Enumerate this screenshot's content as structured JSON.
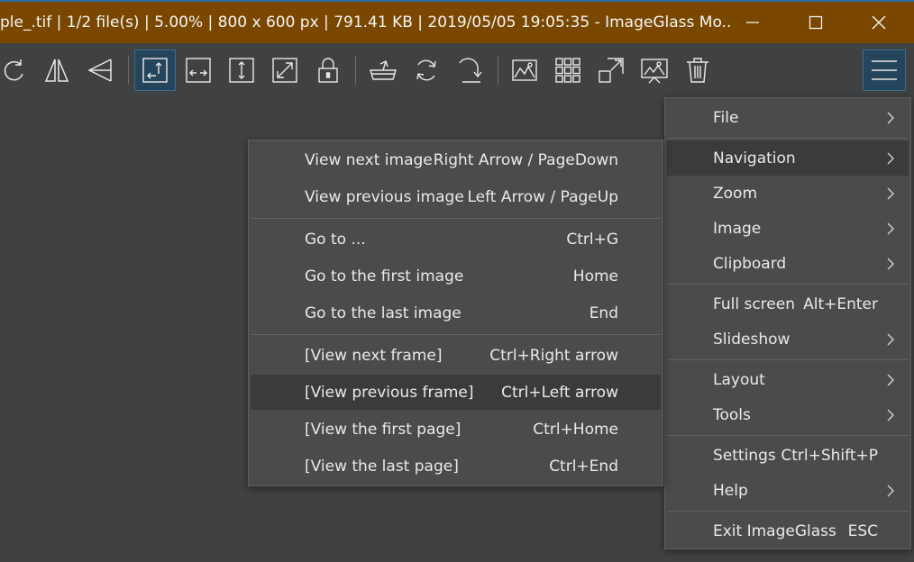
{
  "titlebar": {
    "text": "ple_.tif  |  1/2 file(s)  |  5.00%  |  800 x 600 px  |  791.41 KB  |  2019/05/05 19:05:35  - ImageGlass Mo..."
  },
  "toolbar": {
    "icons": [
      "rotate-right-icon",
      "flip-horizontal-icon",
      "flip-vertical-icon",
      "auto-zoom-icon",
      "fit-width-icon",
      "fit-height-icon",
      "scale-to-fill-icon",
      "lock-zoom-icon",
      "open-with-icon",
      "refresh-icon",
      "goto-icon",
      "set-wallpaper-icon",
      "thumbnail-icon",
      "fullscreen-icon",
      "slideshow-icon",
      "delete-icon",
      "main-menu-icon"
    ],
    "active_icon": "auto-zoom-icon",
    "active_color": "#25455c"
  },
  "main_menu": {
    "items": [
      {
        "label": "File",
        "shortcut": "",
        "submenu": true
      },
      {
        "label": "Navigation",
        "shortcut": "",
        "submenu": true
      },
      {
        "label": "Zoom",
        "shortcut": "",
        "submenu": true
      },
      {
        "label": "Image",
        "shortcut": "",
        "submenu": true
      },
      {
        "label": "Clipboard",
        "shortcut": "",
        "submenu": true
      },
      {
        "label": "Full screen",
        "shortcut": "Alt+Enter",
        "submenu": false
      },
      {
        "label": "Slideshow",
        "shortcut": "",
        "submenu": true
      },
      {
        "label": "Layout",
        "shortcut": "",
        "submenu": true
      },
      {
        "label": "Tools",
        "shortcut": "",
        "submenu": true
      },
      {
        "label": "Settings",
        "shortcut": "Ctrl+Shift+P",
        "submenu": false
      },
      {
        "label": "Help",
        "shortcut": "",
        "submenu": true
      },
      {
        "label": "Exit ImageGlass",
        "shortcut": "ESC",
        "submenu": false
      }
    ],
    "highlighted": "Navigation"
  },
  "nav_menu": {
    "items": [
      {
        "label": "View next image",
        "shortcut": "Right Arrow / PageDown"
      },
      {
        "label": "View previous image",
        "shortcut": "Left Arrow / PageUp"
      },
      {
        "label": "Go to ...",
        "shortcut": "Ctrl+G"
      },
      {
        "label": "Go to the first image",
        "shortcut": "Home"
      },
      {
        "label": "Go to the last image",
        "shortcut": "End"
      },
      {
        "label": "[View next frame]",
        "shortcut": "Ctrl+Right arrow"
      },
      {
        "label": "[View previous frame]",
        "shortcut": "Ctrl+Left arrow"
      },
      {
        "label": "[View the first page]",
        "shortcut": "Ctrl+Home"
      },
      {
        "label": "[View the last page]",
        "shortcut": "Ctrl+End"
      }
    ],
    "highlighted": "[View previous frame]"
  },
  "colors": {
    "titlebar": "#7a4700",
    "background": "#404142",
    "menu": "#4a4b4c",
    "highlight": "#3a3b3c",
    "accent": "#25455c"
  }
}
